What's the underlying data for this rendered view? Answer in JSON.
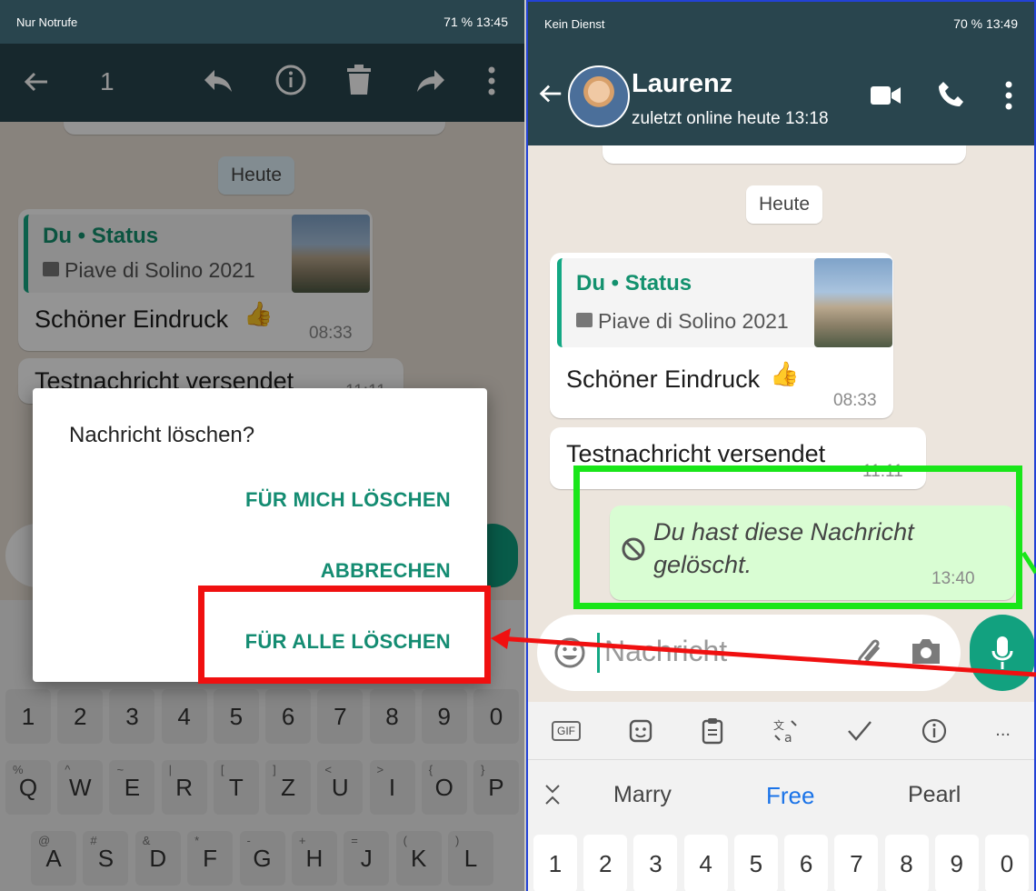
{
  "left": {
    "status_left": "Nur Notrufe",
    "status_right": "71 %  13:45",
    "selection_count": "1",
    "date_chip": "Heute",
    "quote_title": "Du • Status",
    "quote_sub": "Piave di Solino 2021",
    "message_text": "Schöner Eindruck",
    "message_time": "08:33",
    "partial_message": "Testnachricht versendet",
    "partial_time": "11:11",
    "dialog": {
      "title": "Nachricht löschen?",
      "btn_me": "FÜR MICH LÖSCHEN",
      "btn_cancel": "ABBRECHEN",
      "btn_all": "FÜR ALLE LÖSCHEN"
    },
    "keyboard": {
      "row1": [
        "1",
        "2",
        "3",
        "4",
        "5",
        "6",
        "7",
        "8",
        "9",
        "0"
      ],
      "row2": [
        [
          "%",
          "Q"
        ],
        [
          "^",
          "W"
        ],
        [
          "~",
          "E"
        ],
        [
          "|",
          "R"
        ],
        [
          "[",
          "T"
        ],
        [
          "]",
          "Z"
        ],
        [
          "<",
          "U"
        ],
        [
          ">",
          "I"
        ],
        [
          "{",
          "O"
        ],
        [
          "}",
          "P"
        ]
      ],
      "row3": [
        [
          "@",
          "A"
        ],
        [
          "#",
          "S"
        ],
        [
          "&",
          "D"
        ],
        [
          "*",
          "F"
        ],
        [
          "-",
          "G"
        ],
        [
          "+",
          "H"
        ],
        [
          "=",
          "J"
        ],
        [
          "(",
          "K"
        ],
        [
          ")",
          "L"
        ]
      ]
    }
  },
  "right": {
    "status_left": "Kein Dienst",
    "status_right": "70 %  13:49",
    "contact_name": "Laurenz",
    "contact_status": "zuletzt online heute 13:18",
    "date_chip": "Heute",
    "quote_title": "Du • Status",
    "quote_sub": "Piave di Solino 2021",
    "message_text": "Schöner Eindruck",
    "message_time": "08:33",
    "message2_text": "Testnachricht versendet",
    "message2_time": "11:11",
    "deleted_line1": "Du hast diese Nachricht",
    "deleted_line2": "gelöscht.",
    "deleted_time": "13:40",
    "input_placeholder": "Nachricht",
    "suggestions": [
      "Marry",
      "Free",
      "Pearl"
    ],
    "number_row": [
      "1",
      "2",
      "3",
      "4",
      "5",
      "6",
      "7",
      "8",
      "9",
      "0"
    ],
    "gif_label": "GIF",
    "more_label": "..."
  },
  "colors": {
    "appbar": "#29454e",
    "accent": "#13a884",
    "sent_bubble": "#d9fdd3",
    "highlight_red": "#f01010",
    "highlight_green": "#19e619"
  }
}
